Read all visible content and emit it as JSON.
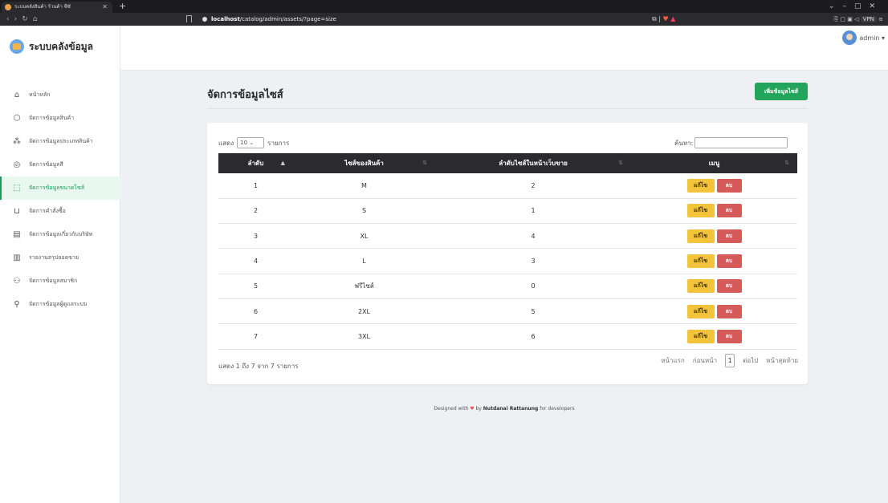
{
  "browser": {
    "tab_title": "ระบบคลังสินค้า ร้านค้า ซีซั",
    "url_host": "localhost",
    "url_path": "/catalog/admin/assets/?page=size",
    "vpn_label": "VPN"
  },
  "brand": {
    "name": "ระบบคลังข้อมูล"
  },
  "sidebar": {
    "items": [
      {
        "label": "หน้าหลัก",
        "icon": "home-icon"
      },
      {
        "label": "จัดการข้อมูลสินค้า",
        "icon": "box-icon"
      },
      {
        "label": "จัดการข้อมูลประเภทสินค้า",
        "icon": "category-icon"
      },
      {
        "label": "จัดการข้อมูลสี",
        "icon": "palette-icon"
      },
      {
        "label": "จัดการข้อมูลขนาดไซส์",
        "icon": "size-icon",
        "active": true
      },
      {
        "label": "จัดการคำสั่งซื้อ",
        "icon": "cart-icon"
      },
      {
        "label": "จัดการข้อมูลเกี่ยวกับบริษัท",
        "icon": "company-icon"
      },
      {
        "label": "รายงานสรุปยอดขาย",
        "icon": "report-icon"
      },
      {
        "label": "จัดการข้อมูลสมาชิก",
        "icon": "members-icon"
      },
      {
        "label": "จัดการข้อมูลผู้ดูแลระบบ",
        "icon": "admin-user-icon"
      }
    ]
  },
  "header": {
    "user_name": "admin"
  },
  "main": {
    "title": "จัดการข้อมูลไซส์",
    "add_button": "เพิ่มข้อมูลไซส์",
    "length_prefix": "แสดง",
    "length_value": "10",
    "length_suffix": "รายการ",
    "search_label": "ค้นหา:",
    "columns": [
      "ลำดับ",
      "ไซส์ของสินค้า",
      "ลำดับไซส์ในหน้าเว็บขาย",
      "เมนู"
    ],
    "rows": [
      [
        "1",
        "M",
        "2"
      ],
      [
        "2",
        "S",
        "1"
      ],
      [
        "3",
        "XL",
        "4"
      ],
      [
        "4",
        "L",
        "3"
      ],
      [
        "5",
        "ฟรีไซส์",
        "0"
      ],
      [
        "6",
        "2XL",
        "5"
      ],
      [
        "7",
        "3XL",
        "6"
      ]
    ],
    "edit_label": "แก้ไข",
    "delete_label": "ลบ",
    "info": "แสดง 1 ถึง 7 จาก 7 รายการ",
    "pager": {
      "first": "หน้าแรก",
      "prev": "ก่อนหน้า",
      "current": "1",
      "next": "ต่อไป",
      "last": "หน้าสุดท้าย"
    }
  },
  "footer": {
    "prefix": "Designed with",
    "by": "by",
    "author": "Nutdanai Rattanung",
    "suffix": "for developers"
  },
  "colors": {
    "accent": "#22a55a",
    "edit": "#f2c33b",
    "delete": "#d65a5a",
    "table_head": "#2a2a2f"
  }
}
